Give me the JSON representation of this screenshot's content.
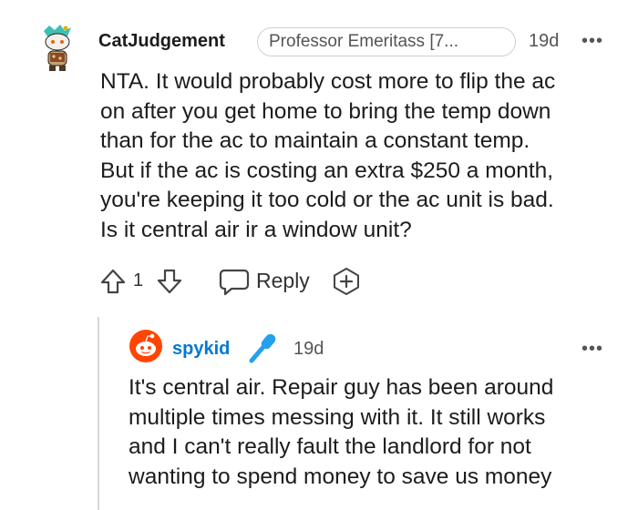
{
  "comment": {
    "username": "CatJudgement",
    "flair": "Professor Emeritass [7...",
    "time": "19d",
    "more": "•••",
    "body": "NTA. It would probably cost more to flip the ac\non after you get home to bring the temp down\nthan for the ac to maintain a constant temp.\nBut if the ac is costing an extra $250 a month,\nyou're keeping it too cold or the ac unit is bad.\nIs it central air ir a window unit?",
    "actions": {
      "vote_count": "1",
      "reply_label": "Reply"
    }
  },
  "reply": {
    "username": "spykid",
    "time": "19d",
    "more": "•••",
    "body": "It's central air. Repair guy has been around\nmultiple times messing with it. It still works\nand I can't really fault the landlord for not\nwanting to spend money to save us money"
  },
  "colors": {
    "text": "#1c1c1c",
    "secondary": "#555555",
    "op_username_blue": "#0079d3",
    "snoo_red": "#ff4500",
    "mic_blue": "#24a0ed",
    "thread_line": "#d6d6d6"
  },
  "icons": [
    "snoo-avatar-icon",
    "upvote-icon",
    "downvote-icon",
    "reply-bubble-icon",
    "award-plus-icon",
    "microphone-icon",
    "more-options-icon"
  ]
}
